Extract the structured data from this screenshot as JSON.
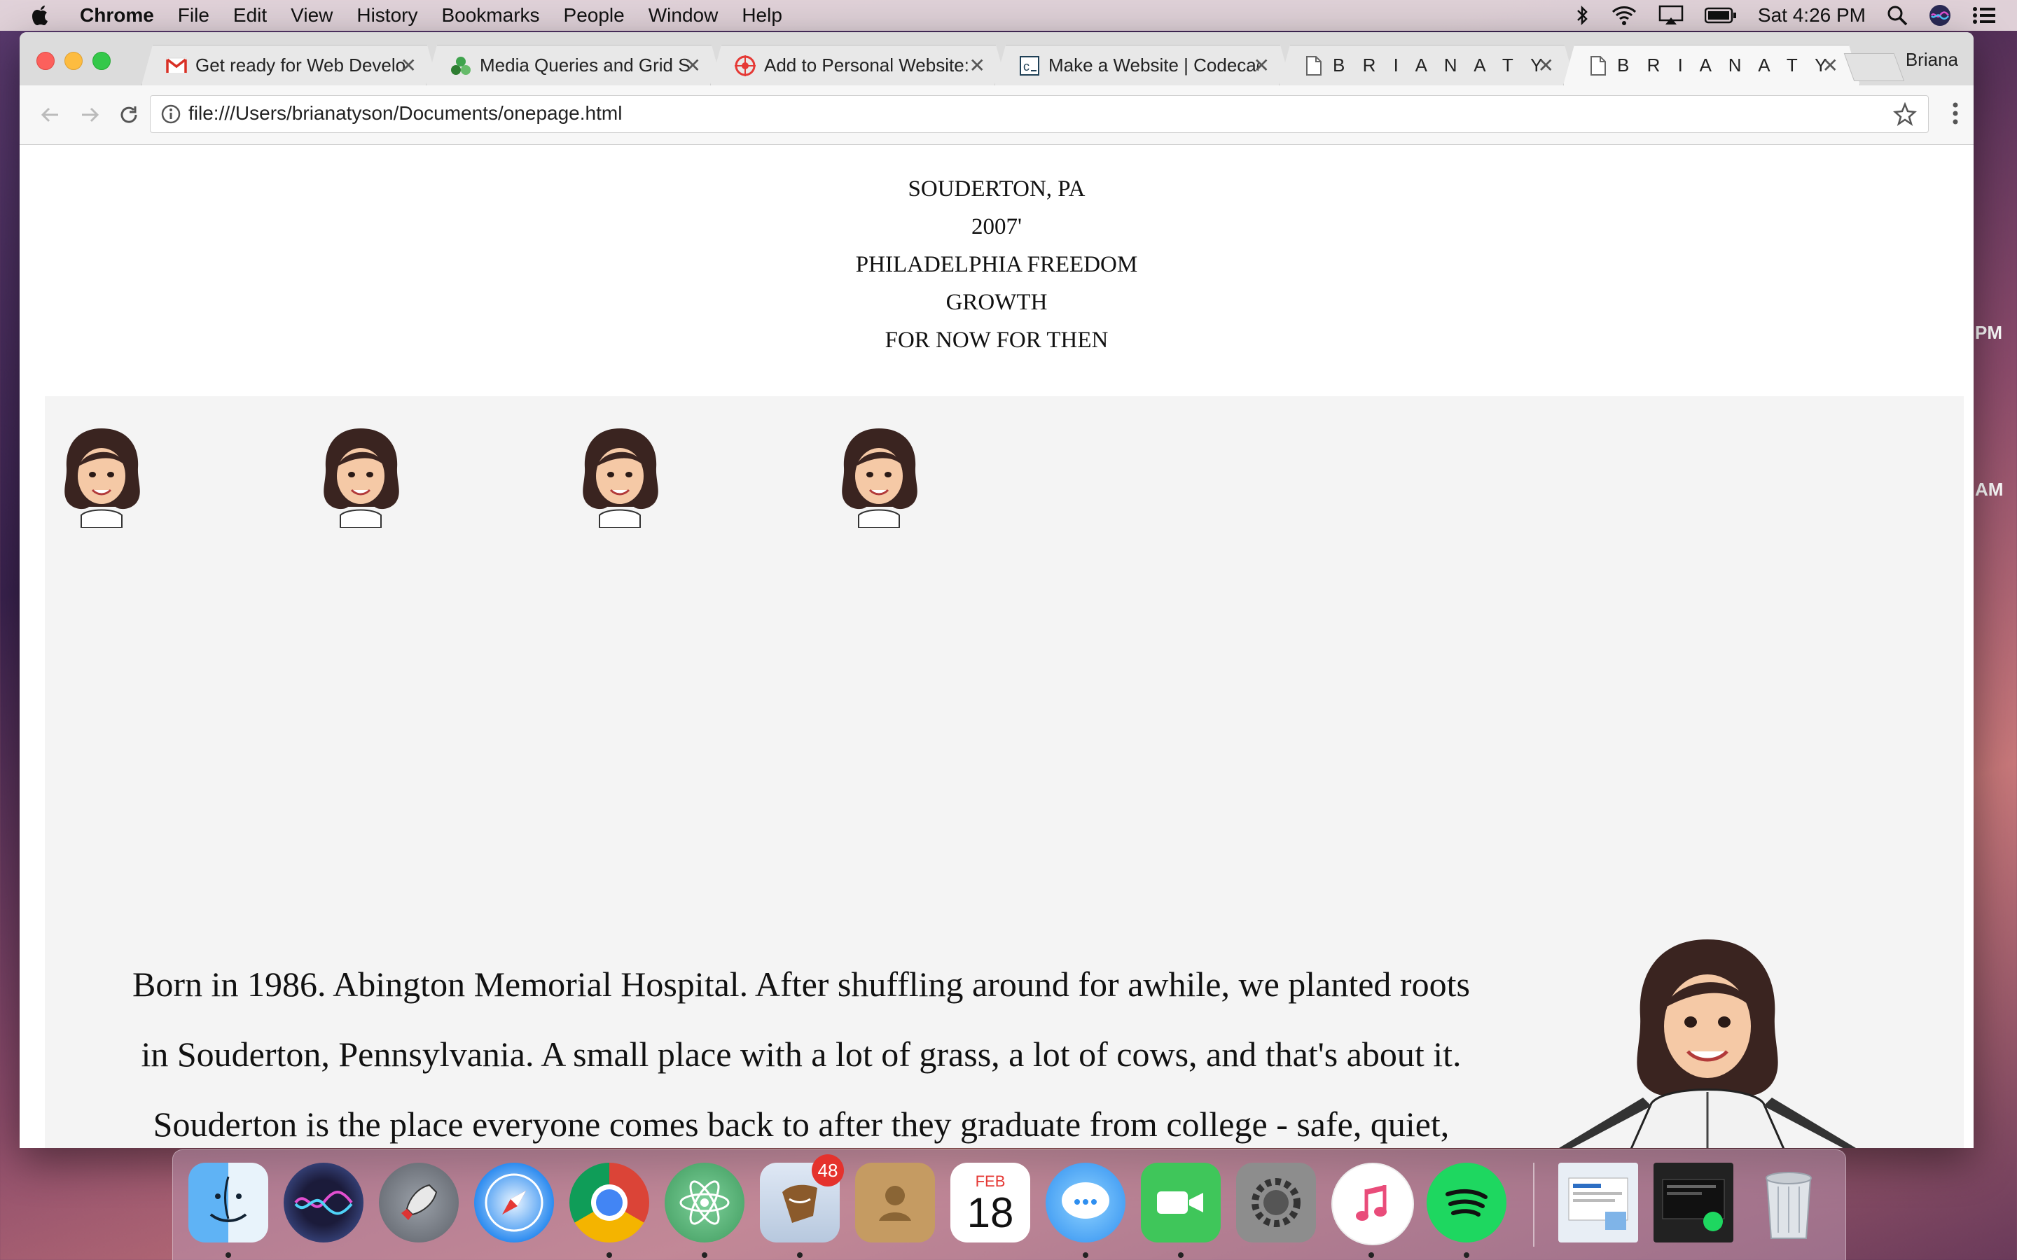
{
  "menubar": {
    "app": "Chrome",
    "items": [
      "File",
      "Edit",
      "View",
      "History",
      "Bookmarks",
      "People",
      "Window",
      "Help"
    ],
    "clock": "Sat 4:26 PM"
  },
  "tabs": [
    {
      "title": "Get ready for Web Develop",
      "icon": "gmail-icon"
    },
    {
      "title": "Media Queries and Grid Sy",
      "icon": "grid-icon"
    },
    {
      "title": "Add to Personal Website: ",
      "icon": "target-icon"
    },
    {
      "title": "Make a Website | Codecad",
      "icon": "codecademy-icon"
    },
    {
      "title": "B R I A N A T Y S O N",
      "icon": "document-icon"
    },
    {
      "title": "B R I A N A T Y S O N",
      "icon": "document-icon"
    }
  ],
  "profile": "Briana",
  "address": {
    "url": "file:///Users/brianatyson/Documents/onepage.html"
  },
  "page": {
    "header_lines": [
      "SOUDERTON, PA",
      "2007'",
      "PHILADELPHIA FREEDOM",
      "GROWTH",
      "FOR NOW FOR THEN"
    ],
    "bio": "Born in 1986. Abington Memorial Hospital. After shuffling around for awhile, we planted roots in Souderton, Pennsylvania. A small place with a lot of grass, a lot of cows, and that's about it. Souderton is the place everyone comes back to after they graduate from college - safe, quiet, perfect"
  },
  "dock": {
    "mail_badge": "48",
    "calendar_month": "FEB",
    "calendar_day": "18"
  },
  "edge": {
    "pm": "PM",
    "am": "AM"
  }
}
